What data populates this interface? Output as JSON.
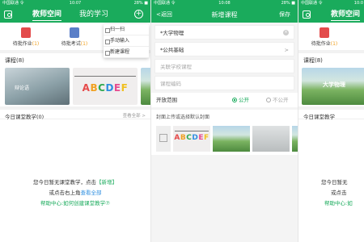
{
  "status": {
    "phone1": {
      "carrier": "中国联通 令",
      "time": "10:07",
      "right": "28% ■"
    },
    "phone2": {
      "carrier": "中国联通 令",
      "time": "10:08",
      "right": "28% ■"
    },
    "phone3": {
      "carrier": "中国联通 令",
      "time": "10:0"
    }
  },
  "home": {
    "tabs": [
      "教师空间",
      "我的学习"
    ],
    "plus": "+",
    "shortcuts": [
      {
        "label": "待批作业",
        "count": "(1)",
        "icon": "homework-icon",
        "color": "#e34b4b"
      },
      {
        "label": "待批考试",
        "count": "(1)",
        "icon": "exam-icon",
        "color": "#5b7fc8"
      }
    ],
    "courses_header": "课程(8)",
    "course_thumbs": [
      {
        "name": "book-cover",
        "word": "辩论语"
      },
      {
        "name": "abc-cover",
        "text": "ABCDEF"
      },
      {
        "name": "hill-cover"
      }
    ],
    "today": {
      "title": "今日课堂教学(0)",
      "view_all": "查看全部 >"
    },
    "empty": {
      "line1_prefix": "您今日暂无课堂教学，点击",
      "line1_link": "【新增】",
      "line2_prefix": "或点击右上角",
      "line2_link": "查看全部",
      "help": "帮助中心:如何创建课堂教学⑦"
    },
    "dropdown": [
      "扫一扫",
      "手动输入",
      "新建课程"
    ]
  },
  "new_course": {
    "back": "<返回",
    "title": "新增课程",
    "save": "保存",
    "name_value": "*大学物理",
    "clear": "×",
    "category_value": "*公共基础",
    "category_arrow": ">",
    "school_placeholder": "关联学校课程",
    "code_placeholder": "课程编码",
    "scope_label": "开放范围",
    "scope_public": "公开",
    "scope_private": "不公开",
    "cover_label": "封面上传或选择默认封面",
    "covers": [
      {
        "name": "abc-cover",
        "text": "ABCDEF"
      },
      {
        "name": "hill-cover"
      },
      {
        "name": "desk-cover"
      }
    ]
  },
  "home_after": {
    "tab": "教师空间",
    "shortcut": {
      "label": "待批作业",
      "count": "(1)"
    },
    "courses_header": "课程(8)",
    "new_course_title": "大学物理",
    "today_title": "今日课堂教学",
    "empty_line1": "您今日暂无",
    "empty_line2": "或点击",
    "empty_help": "帮助中心:如"
  }
}
